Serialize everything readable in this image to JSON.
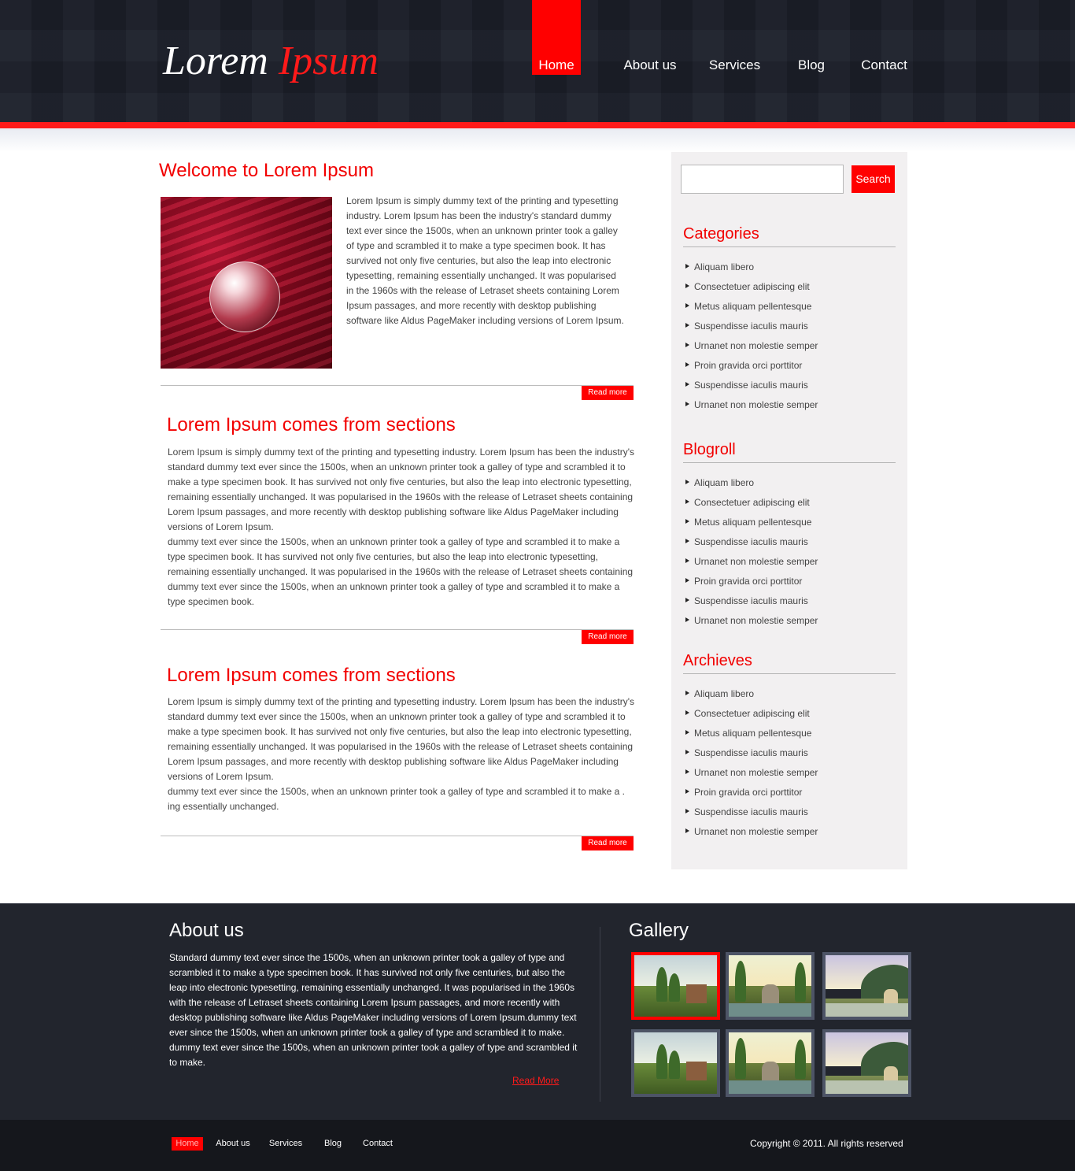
{
  "brand": {
    "logo_main": "Lorem",
    "logo_accent": "Ipsum"
  },
  "nav": [
    {
      "label": "Home",
      "active": true
    },
    {
      "label": "About us",
      "active": false
    },
    {
      "label": "Services",
      "active": false
    },
    {
      "label": "Blog",
      "active": false
    },
    {
      "label": "Contact",
      "active": false
    }
  ],
  "main": {
    "posts": [
      {
        "title": "Welcome to Lorem Ipsum",
        "image": "crystal-ball-on-red-fabric",
        "body": "Lorem Ipsum is simply dummy text of the printing and typesetting industry. Lorem Ipsum has been the industry's standard dummy text ever since the 1500s, when an unknown printer took a galley of type and scrambled it to make a type specimen book. It has survived not only five centuries, but also the leap into electronic typesetting, remaining essentially unchanged. It was popularised in the 1960s with the release of Letraset sheets containing Lorem Ipsum passages, and more recently with desktop publishing software like Aldus PageMaker including versions of Lorem Ipsum.",
        "read_more": "Read more"
      },
      {
        "title": "Lorem Ipsum comes from sections",
        "body": "Lorem Ipsum is simply dummy text of the printing and typesetting industry. Lorem Ipsum has been the industry's standard dummy text ever since the 1500s, when an unknown printer took a galley of type and scrambled it to make a type specimen book. It has survived not only five centuries, but also the leap into electronic typesetting, remaining essentially unchanged. It was popularised in the 1960s with the release of Letraset sheets containing Lorem Ipsum passages, and more recently with desktop publishing software like Aldus PageMaker including versions of Lorem Ipsum.",
        "body2": "dummy text ever since the 1500s, when an unknown printer took a galley of type and scrambled it to make a type specimen book. It has survived not only five centuries, but also the leap into electronic typesetting, remaining essentially unchanged. It was popularised in the 1960s with the release of Letraset sheets containing dummy text ever since the 1500s, when an unknown printer took a galley of type and scrambled it to make a type specimen book.",
        "read_more": "Read more"
      },
      {
        "title": "Lorem Ipsum comes from sections",
        "body": "Lorem Ipsum is simply dummy text of the printing and typesetting industry. Lorem Ipsum has been the industry's standard dummy text ever since the 1500s, when an unknown printer took a galley of type and scrambled it to make a type specimen book. It has survived not only five centuries, but also the leap into electronic typesetting, remaining essentially unchanged. It was popularised in the 1960s with the release of Letraset sheets containing Lorem Ipsum passages, and more recently with desktop publishing software like Aldus PageMaker including versions of Lorem Ipsum.",
        "body2": "dummy text ever since the 1500s, when an unknown printer took a galley of type and scrambled it to make a . ing essentially unchanged.",
        "read_more": "Read more"
      }
    ]
  },
  "sidebar": {
    "search": {
      "placeholder": "",
      "value": "",
      "button_label": "Search"
    },
    "sections": [
      {
        "title": "Categories",
        "items": [
          "Aliquam libero",
          "Consectetuer adipiscing elit",
          "Metus aliquam pellentesque",
          "Suspendisse iaculis mauris",
          "Urnanet non molestie semper",
          "Proin gravida orci porttitor",
          "Suspendisse iaculis mauris",
          "Urnanet non molestie semper"
        ]
      },
      {
        "title": "Blogroll",
        "items": [
          "Aliquam libero",
          "Consectetuer adipiscing elit",
          "Metus aliquam pellentesque",
          "Suspendisse iaculis mauris",
          "Urnanet non molestie semper",
          "Proin gravida orci porttitor",
          "Suspendisse iaculis mauris",
          "Urnanet non molestie semper"
        ]
      },
      {
        "title": "Archieves",
        "items": [
          "Aliquam libero",
          "Consectetuer adipiscing elit",
          "Metus aliquam pellentesque",
          "Suspendisse iaculis mauris",
          "Urnanet non molestie semper",
          "Proin gravida orci porttitor",
          "Suspendisse iaculis mauris",
          "Urnanet non molestie semper"
        ]
      }
    ]
  },
  "footer": {
    "about": {
      "title": "About us",
      "text": "Standard dummy text ever since the 1500s, when an unknown printer took a galley of type and scrambled it to make a type specimen book. It has survived not only five centuries, but also the leap into electronic typesetting, remaining essentially unchanged. It was popularised in the 1960s with the release of Letraset sheets containing Lorem Ipsum passages, and more recently with desktop publishing software like Aldus PageMaker including versions of Lorem Ipsum.dummy text ever since the 1500s, when an unknown printer took a galley of type and scrambled it to make. dummy text ever since the 1500s, when an unknown printer took a galley of type and scrambled it to make.",
      "read_more": "Read More"
    },
    "gallery": {
      "title": "Gallery",
      "thumbs": [
        {
          "image": "cottage-landscape",
          "selected": true
        },
        {
          "image": "gazebo-pond",
          "selected": false
        },
        {
          "image": "lake-gazebo",
          "selected": false
        },
        {
          "image": "cottage-landscape",
          "selected": false
        },
        {
          "image": "gazebo-pond",
          "selected": false
        },
        {
          "image": "lake-gazebo",
          "selected": false
        }
      ]
    },
    "nav": [
      {
        "label": "Home",
        "active": true
      },
      {
        "label": "About us",
        "active": false
      },
      {
        "label": "Services",
        "active": false
      },
      {
        "label": "Blog",
        "active": false
      },
      {
        "label": "Contact",
        "active": false
      }
    ],
    "copyright": "Copyright © 2011. All rights reserved"
  },
  "colors": {
    "accent": "#ff0000",
    "header_bg": "#1b1f29",
    "footer_bg": "#22252d",
    "sidebar_bg": "#f2f0f1"
  }
}
